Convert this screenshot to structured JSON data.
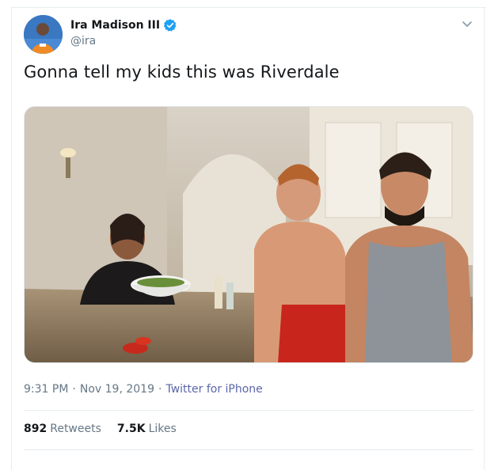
{
  "tweet": {
    "author_name": "Ira Madison III",
    "handle": "@ira",
    "text": "Gonna tell my kids this was Riverdale",
    "time": "9:31 PM",
    "date": "Nov 19, 2019",
    "source": "Twitter for iPhone",
    "separator": "·"
  },
  "stats": {
    "retweets_count": "892",
    "retweets_label": "Retweets",
    "likes_count": "7.5K",
    "likes_label": "Likes"
  },
  "icons": {
    "verified": "verified-badge-icon",
    "more": "chevron-down-icon"
  },
  "colors": {
    "verified_blue": "#1da1f2",
    "muted_text": "#657786",
    "source_link": "#5b66a8",
    "divider": "#e6ecf0"
  }
}
